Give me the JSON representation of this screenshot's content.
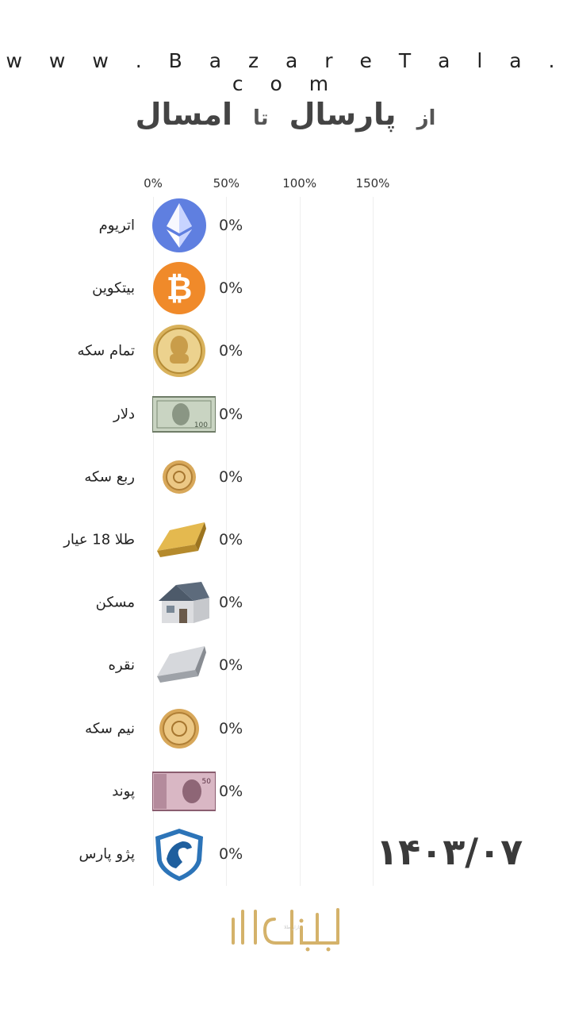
{
  "header": {
    "site": "w w w . B a z a r e T a l a . c o m",
    "word_from": "از",
    "word_last_year": "پارسال",
    "word_to": "تا",
    "word_this_year": "امسال"
  },
  "date": "۱۴۰۳/۰۷",
  "logo_text": "بازار طلا",
  "chart_data": {
    "type": "bar",
    "orientation": "horizontal",
    "xticks": [
      "0%",
      "50%",
      "100%",
      "150%"
    ],
    "xlim": [
      0,
      150
    ],
    "grid": true,
    "categories": [
      "اتریوم",
      "بیتکوین",
      "تمام سکه",
      "دلار",
      "ربع سکه",
      "طلا 18 عیار",
      "مسکن",
      "نقره",
      "نیم سکه",
      "پوند",
      "پژو پارس"
    ],
    "icons": [
      "ethereum-icon",
      "bitcoin-icon",
      "full-coin-icon",
      "dollar-note-icon",
      "quarter-coin-icon",
      "gold-bar-icon",
      "house-icon",
      "silver-bar-icon",
      "half-coin-icon",
      "pound-note-icon",
      "peugeot-pars-logo-icon"
    ],
    "values": [
      0,
      0,
      0,
      0,
      0,
      0,
      0,
      0,
      0,
      0,
      0
    ],
    "value_labels": [
      "0%",
      "0%",
      "0%",
      "0%",
      "0%",
      "0%",
      "0%",
      "0%",
      "0%",
      "0%",
      "0%"
    ]
  }
}
